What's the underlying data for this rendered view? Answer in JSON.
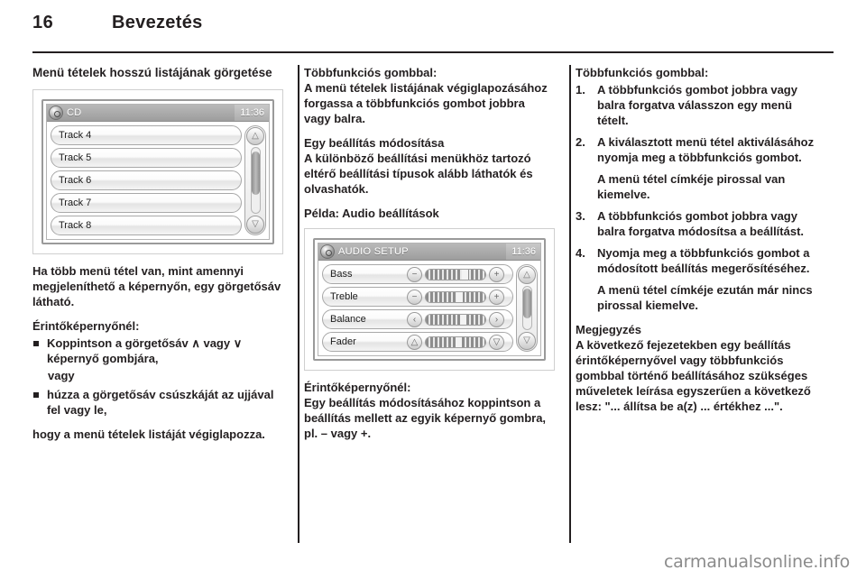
{
  "header": {
    "page_number": "16",
    "chapter": "Bevezetés"
  },
  "columns": {
    "left": {
      "section_title": "Menü tételek hosszú listájának görgetése",
      "cd_screen": {
        "icon": "cd-disc-icon",
        "title": "CD",
        "clock": "11:36",
        "rows": [
          "Track 4",
          "Track 5",
          "Track 6",
          "Track 7",
          "Track 8"
        ],
        "scroll_up_icon": "chevron-up-icon",
        "scroll_down_icon": "chevron-down-icon"
      },
      "para1": "Ha több menü tétel van, mint amennyi megjeleníthető a képernyőn, egy görgetősáv látható.",
      "sub_touch": "Érintőképernyőnél:",
      "bullet1": "Koppintson a görgetősáv ∧ vagy ∨ képernyő gombjára,",
      "or_label": "vagy",
      "bullet2": "húzza a görgetősáv csúszkáját az ujjával fel vagy le,",
      "para2": "hogy a menü tételek listáját végiglapozza."
    },
    "middle": {
      "sub_multifunction": "Többfunkciós gombbal:",
      "para1": "A menü tételek listájának végiglapozásához forgassa a többfunkciós gombot jobbra vagy balra.",
      "sub_change": "Egy beállítás módosítása",
      "para2": "A különböző beállítási menükhöz tartozó eltérő beállítási típusok alább láthatók és olvashatók.",
      "example": "Példa: Audio beállítások",
      "audio_screen": {
        "icon": "audio-note-icon",
        "title": "AUDIO SETUP",
        "clock": "11:36",
        "rows": [
          {
            "label": "Bass",
            "minus_icon": "minus-circle-icon",
            "plus_icon": "plus-circle-icon",
            "value_pct": 60
          },
          {
            "label": "Treble",
            "minus_icon": "minus-circle-icon",
            "plus_icon": "plus-circle-icon",
            "value_pct": 52
          },
          {
            "label": "Balance",
            "minus_icon": "chevron-left-icon",
            "plus_icon": "chevron-right-icon",
            "value_pct": 58
          },
          {
            "label": "Fader",
            "minus_icon": "chevron-up-icon",
            "plus_icon": "chevron-down-icon",
            "value_pct": 50
          }
        ],
        "scroll_up_icon": "chevron-up-icon",
        "scroll_down_icon": "chevron-down-icon"
      },
      "sub_touch": "Érintőképernyőnél:",
      "para3": "Egy beállítás módosításához koppintson a beállítás mellett az egyik képernyő gombra, pl. – vagy +."
    },
    "right": {
      "sub_multifunction": "Többfunkciós gombbal:",
      "steps": [
        {
          "num": "1.",
          "text": "A többfunkciós gombot jobbra vagy balra forgatva válasszon egy menü tételt."
        },
        {
          "num": "2.",
          "text": "A kiválasztott menü tétel aktiválásához nyomja meg a többfunkciós gombot.",
          "sub": "A menü tétel címkéje pirossal van kiemelve."
        },
        {
          "num": "3.",
          "text": "A többfunkciós gombot jobbra vagy balra forgatva módosítsa a beállítást."
        },
        {
          "num": "4.",
          "text": "Nyomja meg a többfunkciós gombot a módosított beállítás megerősítéséhez.",
          "sub": "A menü tétel címkéje ezután már nincs pirossal kiemelve."
        }
      ],
      "note_title": "Megjegyzés",
      "note_text": "A következő fejezetekben egy beállítás érintőképernyővel vagy többfunkciós gombbal történő beállításához szükséges műveletek leírása egyszerűen a következő lesz: \"... állítsa be a(z) ... értékhez ...\"."
    }
  },
  "footer": {
    "watermark": "carmanualsonline.info"
  }
}
